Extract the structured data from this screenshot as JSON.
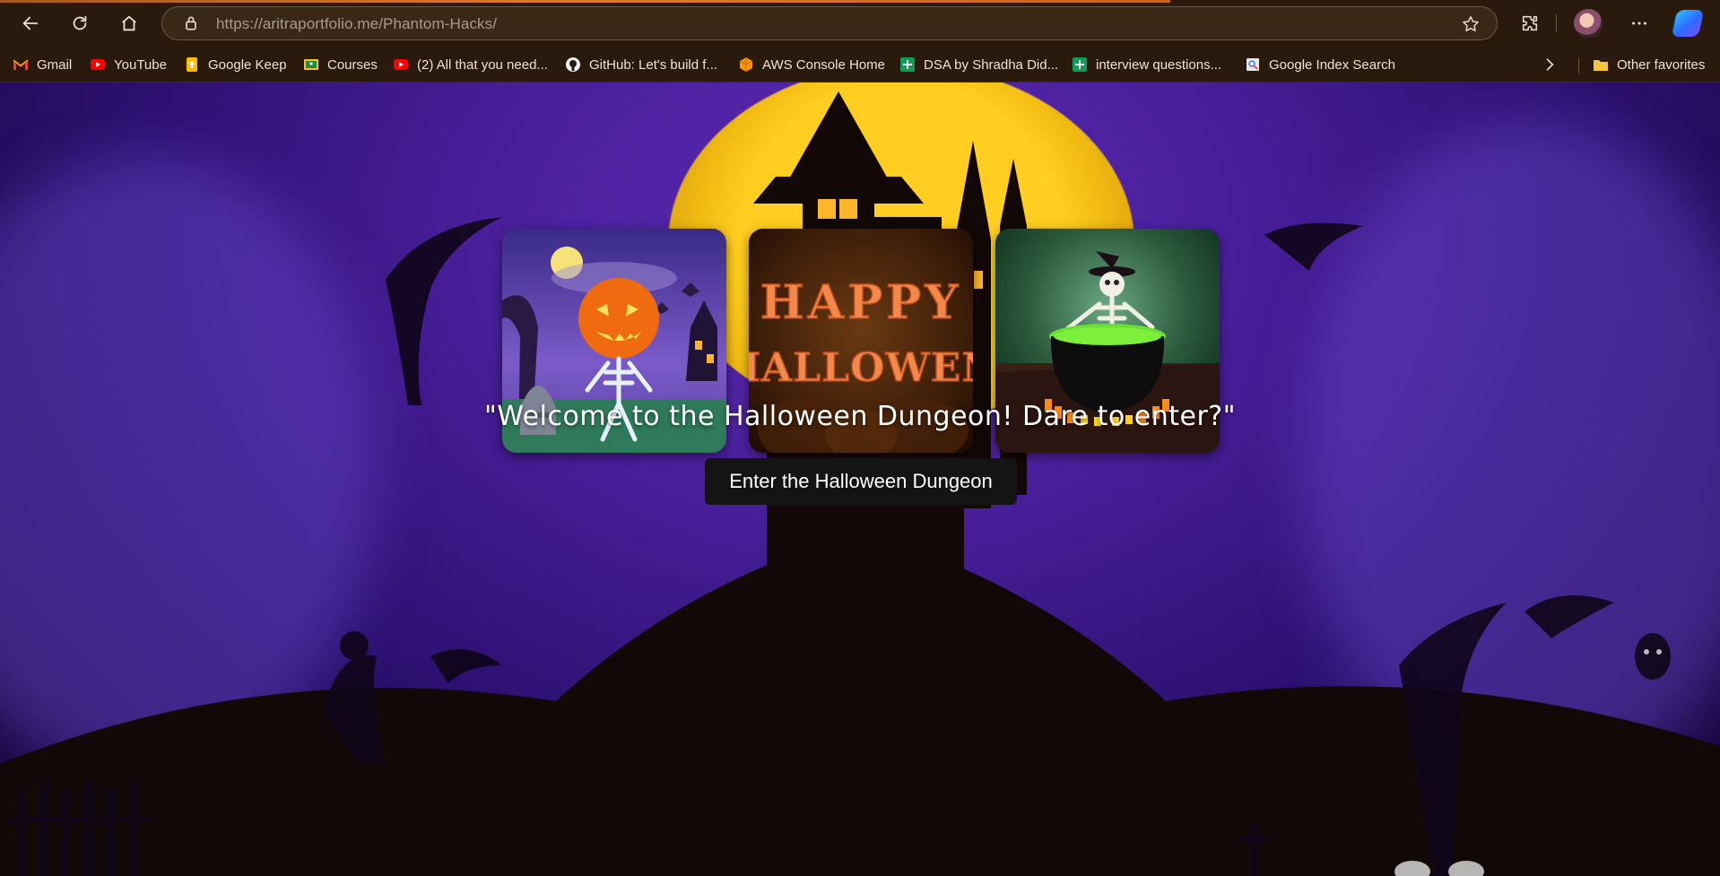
{
  "browser": {
    "url_host": "https://aritraportfolio.me",
    "url_path": "/Phantom-Hacks/",
    "bookmarks": [
      {
        "label": "Gmail",
        "icon": "gmail-icon"
      },
      {
        "label": "YouTube",
        "icon": "youtube-icon"
      },
      {
        "label": "Google Keep",
        "icon": "keep-icon"
      },
      {
        "label": "Courses",
        "icon": "classroom-icon"
      },
      {
        "label": "(2) All that you need...",
        "icon": "youtube-icon"
      },
      {
        "label": "GitHub: Let's build f...",
        "icon": "github-icon"
      },
      {
        "label": "AWS Console Home",
        "icon": "aws-icon"
      },
      {
        "label": "DSA by Shradha Did...",
        "icon": "sheets-icon"
      },
      {
        "label": "interview questions...",
        "icon": "sheets-icon"
      },
      {
        "label": "Google Index Search",
        "icon": "search-console-icon"
      }
    ],
    "other_favorites": "Other favorites"
  },
  "page": {
    "welcome_text": "\"Welcome to the Halloween Dungeon! Dare to enter?\"",
    "enter_button": "Enter the Halloween Dungeon",
    "cards": [
      {
        "name": "pumpkin-skeleton-image"
      },
      {
        "name": "happy-halloween-image",
        "text": "HAPPY HALLOWEEN"
      },
      {
        "name": "skeleton-cauldron-image"
      }
    ]
  },
  "colors": {
    "background_purple": "#4a1f9c",
    "moon_yellow": "#ffce20",
    "button_bg": "#141414"
  }
}
